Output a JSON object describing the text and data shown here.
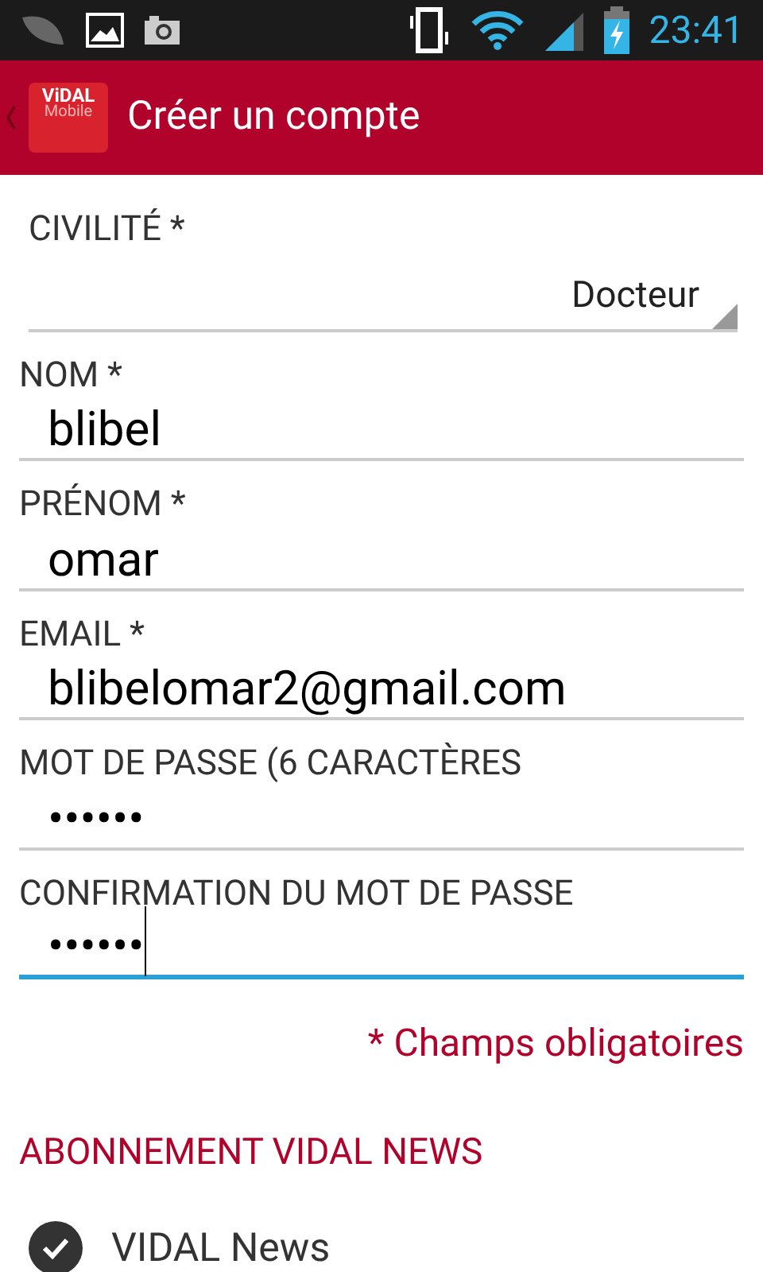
{
  "status_bar": {
    "time": "23:41"
  },
  "app_bar": {
    "logo_top": "ViDAL",
    "logo_bottom": "Mobile",
    "title": "Créer un compte"
  },
  "civility": {
    "label": "CIVILITÉ *",
    "value": "Docteur"
  },
  "fields": [
    {
      "label": "NOM *",
      "value": "blibel",
      "focused": false
    },
    {
      "label": "PRÉNOM *",
      "value": "omar",
      "focused": false
    },
    {
      "label": "EMAIL *",
      "value": "blibelomar2@gmail.com",
      "focused": false
    },
    {
      "label": "MOT DE PASSE (6 CARACTÈRES",
      "value": "••••••",
      "focused": false
    },
    {
      "label": "CONFIRMATION DU MOT DE PASSE",
      "value": "••••••",
      "focused": true
    }
  ],
  "required_note": "* Champs obligatoires",
  "section_title": "ABONNEMENT VIDAL NEWS",
  "subscriptions": [
    {
      "label": "VIDAL News",
      "checked": true
    }
  ]
}
